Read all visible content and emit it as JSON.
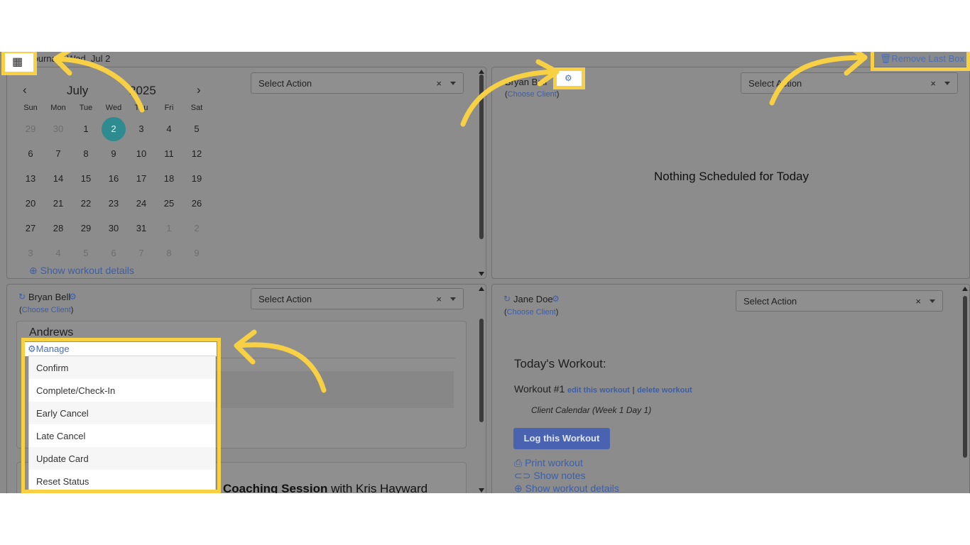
{
  "topbar": {
    "date_label": "Journal - Wed, Jul 2",
    "remove_last_box": "Remove Last Box"
  },
  "calendar": {
    "month": "July",
    "year": "2025",
    "weekdays": [
      "Sun",
      "Mon",
      "Tue",
      "Wed",
      "Thu",
      "Fri",
      "Sat"
    ],
    "weeks": [
      [
        "29",
        "30",
        "1",
        "2",
        "3",
        "4",
        "5"
      ],
      [
        "6",
        "7",
        "8",
        "9",
        "10",
        "11",
        "12"
      ],
      [
        "13",
        "14",
        "15",
        "16",
        "17",
        "18",
        "19"
      ],
      [
        "20",
        "21",
        "22",
        "23",
        "24",
        "25",
        "26"
      ],
      [
        "27",
        "28",
        "29",
        "30",
        "31",
        "1",
        "2"
      ],
      [
        "3",
        "4",
        "5",
        "6",
        "7",
        "8",
        "9"
      ]
    ],
    "selected_day": "2",
    "show_workout_details": "Show workout details"
  },
  "select_action": "Select Action",
  "select_clear": "×",
  "top_right_panel": {
    "client_label": "Bryan Bell",
    "choose_client": "Choose Client",
    "empty_message": "Nothing Scheduled for Today"
  },
  "bottom_left_panel": {
    "client_label": "Bryan Bell",
    "choose_client": "Choose Client",
    "card_title": "Andrews",
    "manage_label": "Manage",
    "menu_items": [
      "Confirm",
      "Complete/Check-In",
      "Early Cancel",
      "Late Cancel",
      "Update Card",
      "Reset Status"
    ],
    "session_bold": "Coaching Session",
    "session_rest": " with Kris Hayward"
  },
  "bottom_right_panel": {
    "client_label": "Jane Doe",
    "choose_client": "Choose Client",
    "todays_workout": "Today's Workout:",
    "workout_title": "Workout #1",
    "edit_workout": "edit this workout",
    "separator": "|",
    "delete_workout": "delete workout",
    "program_note": "Client Calendar (Week 1 Day 1)",
    "log_button": "Log this Workout",
    "print_workout": "Print workout",
    "show_notes": "Show notes",
    "show_workout_details": "Show workout details"
  },
  "colors": {
    "highlight": "#f7d143",
    "link": "#4a6fb8",
    "selected_day": "#2e8b8f",
    "log_button": "#4a63b0"
  }
}
